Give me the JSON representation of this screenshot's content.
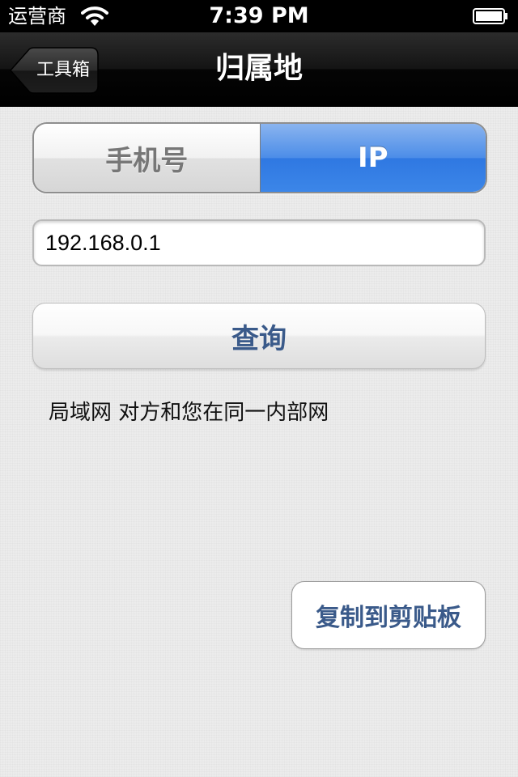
{
  "status_bar": {
    "carrier": "运营商",
    "time": "7:39 PM",
    "wifi_icon": "wifi-icon",
    "battery_icon": "battery-icon"
  },
  "nav": {
    "back_label": "工具箱",
    "title": "归属地"
  },
  "segments": {
    "phone_label": "手机号",
    "ip_label": "IP",
    "selected": "IP"
  },
  "ip_input": {
    "value": "192.168.0.1"
  },
  "query_button": {
    "label": "查询"
  },
  "result": {
    "text": "局域网 对方和您在同一内部网"
  },
  "copy_button": {
    "label": "复制到剪贴板"
  },
  "colors": {
    "accent": "#3a86e8",
    "button_text": "#3a5a8a",
    "nav_bg": "#141414",
    "background": "#ececec"
  }
}
